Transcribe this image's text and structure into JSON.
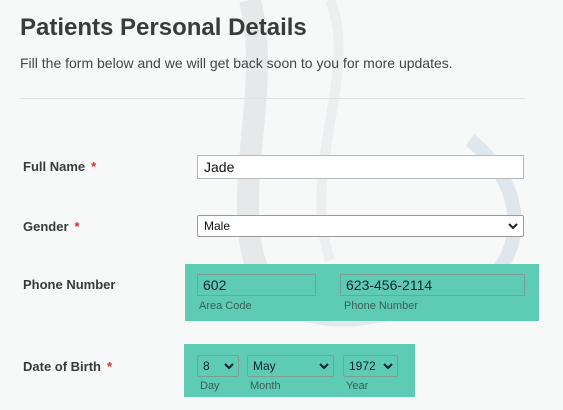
{
  "form": {
    "title": "Patients Personal Details",
    "subtitle": "Fill the form below and we will get back soon to you for more updates."
  },
  "full_name": {
    "label": "Full Name",
    "required_mark": "*",
    "value": "Jade"
  },
  "gender": {
    "label": "Gender",
    "required_mark": "*",
    "selected": "Male"
  },
  "phone": {
    "label": "Phone Number",
    "area_code": {
      "value": "602",
      "sublabel": "Area Code"
    },
    "number": {
      "value": "623-456-2114",
      "sublabel": "Phone Number"
    }
  },
  "dob": {
    "label": "Date of Birth",
    "required_mark": "*",
    "day": {
      "selected": "8",
      "sublabel": "Day"
    },
    "month": {
      "selected": "May",
      "sublabel": "Month"
    },
    "year": {
      "selected": "1972",
      "sublabel": "Year"
    }
  },
  "colors": {
    "highlight": "#5ecbb5",
    "required": "#d0312d"
  },
  "icons": {
    "dropdown": "chevron-down-icon"
  }
}
